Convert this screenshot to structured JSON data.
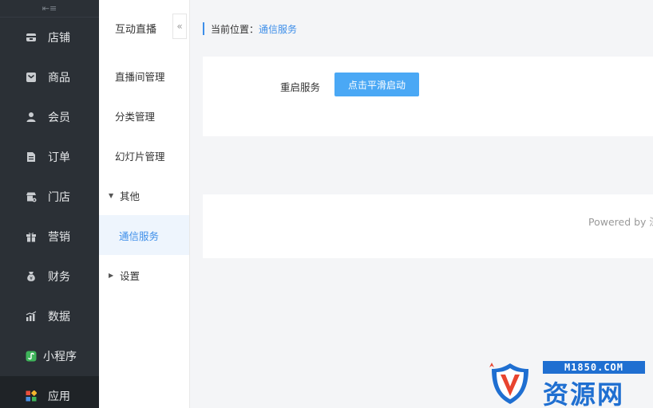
{
  "sidebar": {
    "collapse_glyph": "⇤≡",
    "items": [
      {
        "label": "店铺",
        "icon": "store-icon"
      },
      {
        "label": "商品",
        "icon": "goods-icon"
      },
      {
        "label": "会员",
        "icon": "member-icon"
      },
      {
        "label": "订单",
        "icon": "order-icon"
      },
      {
        "label": "门店",
        "icon": "shop-settings-icon"
      },
      {
        "label": "营销",
        "icon": "gift-icon"
      },
      {
        "label": "财务",
        "icon": "money-bag-icon"
      },
      {
        "label": "数据",
        "icon": "chart-icon"
      },
      {
        "label": "小程序",
        "icon": "mini-program-icon"
      },
      {
        "label": "应用",
        "icon": "apps-icon",
        "active": true
      }
    ]
  },
  "subnav": {
    "title": "互动直播",
    "collapse_glyph": "«",
    "items": [
      {
        "label": "直播间管理"
      },
      {
        "label": "分类管理"
      },
      {
        "label": "幻灯片管理"
      },
      {
        "label": "其他",
        "group": true,
        "expanded": true,
        "caret": "▼"
      },
      {
        "label": "通信服务",
        "active": true
      },
      {
        "label": "设置",
        "group": true,
        "expanded": false,
        "caret": "▶"
      }
    ]
  },
  "breadcrumb": {
    "prefix": "当前位置：",
    "current": "通信服务"
  },
  "panel": {
    "label": "重启服务",
    "button": "点击平滑启动"
  },
  "footer": {
    "text": "Powered by 深"
  },
  "watermark": {
    "domain": "M1850.COM",
    "name": "资源网"
  },
  "colors": {
    "sidebar_bg": "#2b3036",
    "accent": "#3d8ee9",
    "button": "#4aa8f5",
    "watermark": "#1f6fd1"
  }
}
